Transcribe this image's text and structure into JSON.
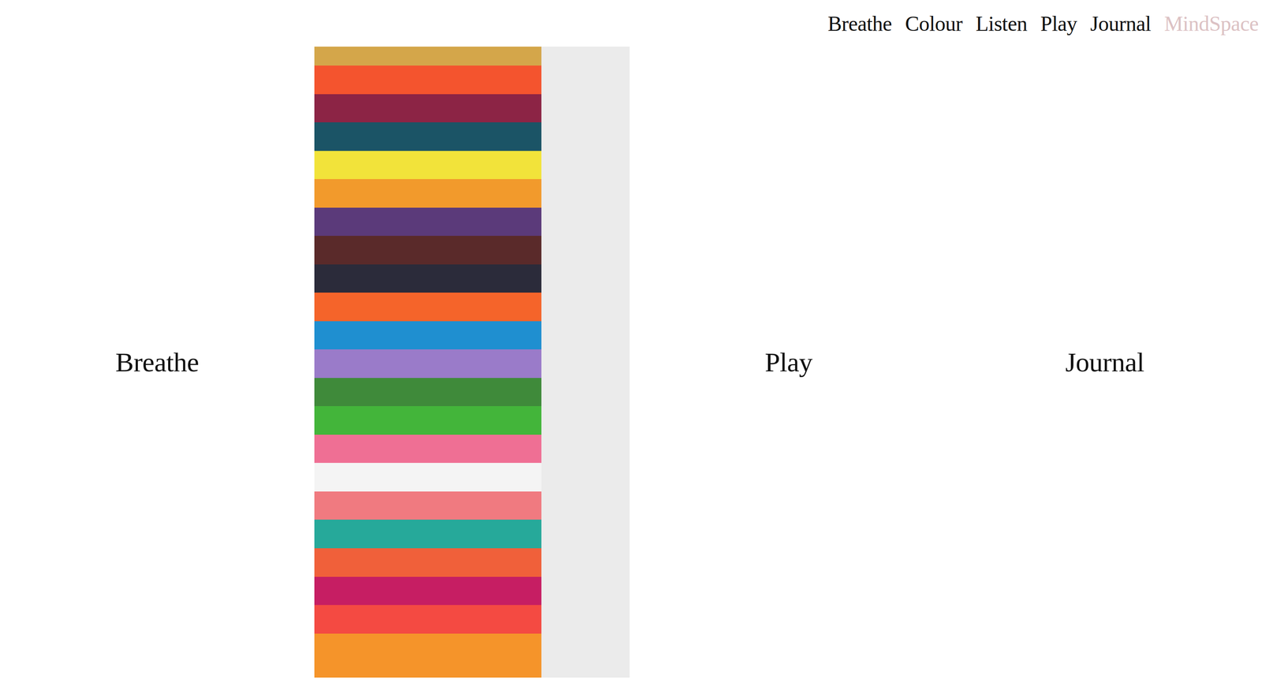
{
  "nav": {
    "items": [
      {
        "label": "Breathe",
        "selected": false
      },
      {
        "label": "Colour",
        "selected": false
      },
      {
        "label": "Listen",
        "selected": false
      },
      {
        "label": "Play",
        "selected": false
      },
      {
        "label": "Journal",
        "selected": false
      }
    ],
    "brand": "MindSpace"
  },
  "tiles": [
    {
      "kind": "text",
      "label": "Breathe"
    },
    {
      "kind": "image"
    },
    {
      "kind": "text",
      "label": "Play"
    },
    {
      "kind": "text",
      "label": "Journal"
    }
  ]
}
